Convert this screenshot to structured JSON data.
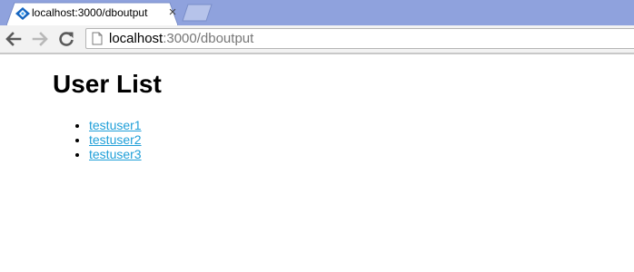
{
  "browser": {
    "tab": {
      "title": "localhost:3000/dboutput",
      "close_glyph": "×",
      "favicon": "blue-diamond-icon"
    },
    "address_bar": {
      "host": "localhost",
      "path": ":3000/dboutput",
      "page_icon": "page-icon"
    },
    "nav_icons": [
      "back-arrow-icon",
      "forward-arrow-icon",
      "reload-icon"
    ],
    "colors": {
      "tabstrip": "#8fa2dd",
      "toolbar": "#f2f2f2",
      "link": "#1f9fd8"
    }
  },
  "page": {
    "title": "User List",
    "users": [
      {
        "name": "testuser1"
      },
      {
        "name": "testuser2"
      },
      {
        "name": "testuser3"
      }
    ]
  }
}
